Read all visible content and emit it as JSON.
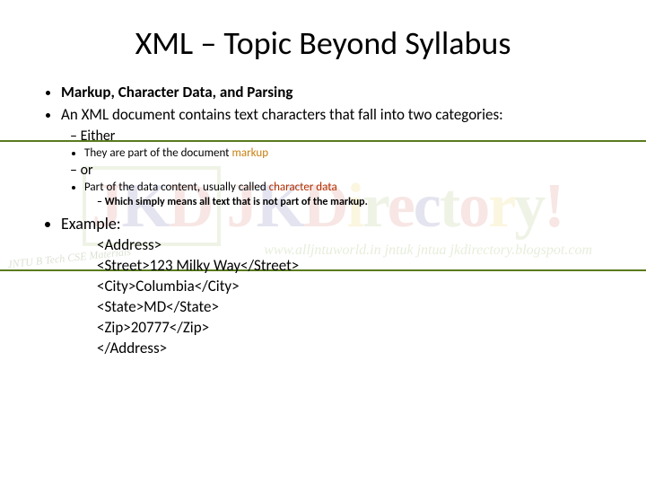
{
  "title": "XML – Topic Beyond Syllabus",
  "b1_heading": "Markup, Character Data, and Parsing",
  "b2_intro": "An XML document contains text characters that fall into two categories:",
  "either_label": "Either",
  "either_detail_pre": "They are part of the document ",
  "either_detail_hl": "markup",
  "or_label": "or",
  "or_detail_pre": "Part of the data content, usually called ",
  "or_detail_hl": "character data",
  "or_subnote": "Which simply means all text that is not part of the markup.",
  "example_label": "Example:",
  "ex_l1": "<Address>",
  "ex_l2": "<Street>123 Milky Way</Street>",
  "ex_l3": "<City>Columbia</City>",
  "ex_l4": "<State>MD</State>",
  "ex_l5": "<Zip>20777</Zip>",
  "ex_l6": "</Address>",
  "watermark_url": "www.alljntuworld.in jntuk jntua jkdirectory.blogspot.com",
  "watermark_left": "JNTU B Tech CSE Materials"
}
